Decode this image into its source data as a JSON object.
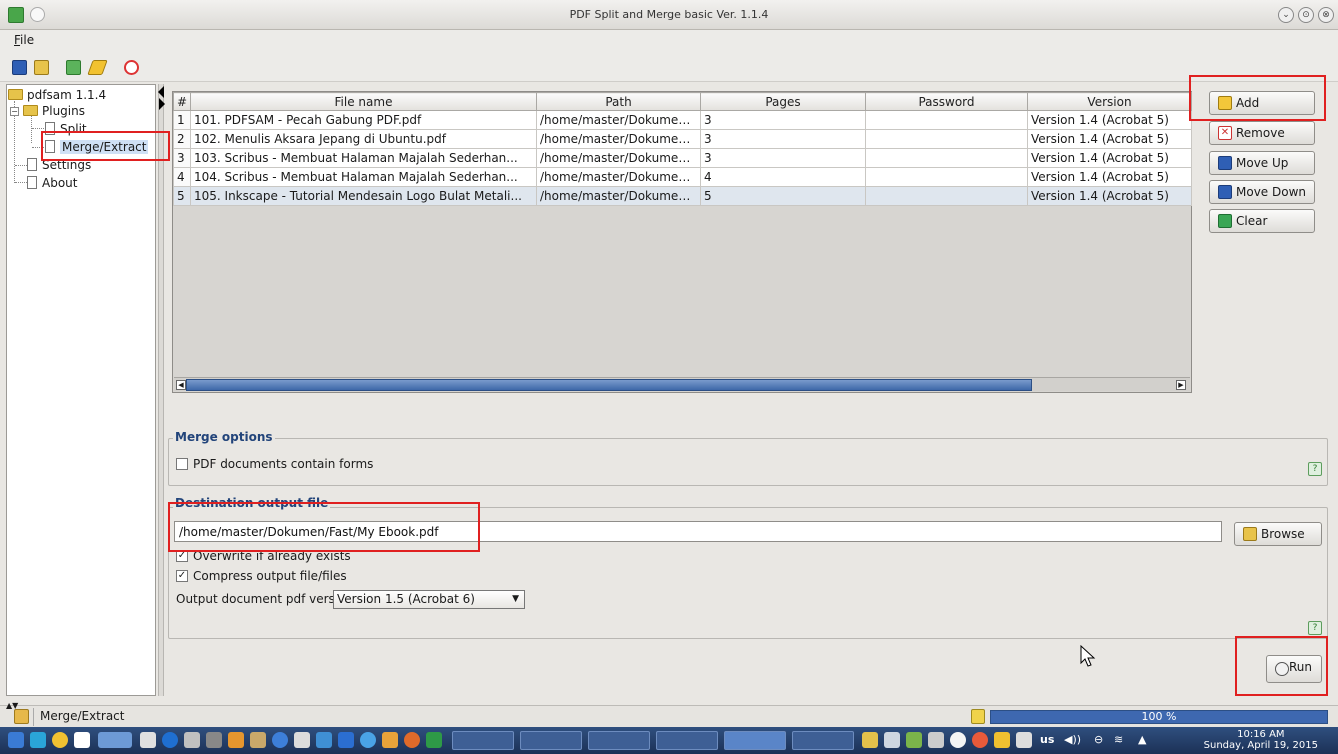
{
  "window": {
    "title": "PDF Split and Merge basic Ver. 1.1.4",
    "controls": [
      "⌄",
      "⊙",
      "⊗"
    ]
  },
  "menubar": {
    "file_mnemonic": "F",
    "file_rest": "ile"
  },
  "tree": {
    "root": "pdfsam 1.1.4",
    "plugins": "Plugins",
    "split": "Split",
    "merge": "Merge/Extract",
    "settings": "Settings",
    "about": "About"
  },
  "table": {
    "headers": [
      "#",
      "File name",
      "Path",
      "Pages",
      "Password",
      "Version"
    ],
    "rows": [
      [
        "1",
        "101. PDFSAM - Pecah Gabung PDF.pdf",
        "/home/master/Dokumen...",
        "3",
        "",
        "Version 1.4 (Acrobat 5)"
      ],
      [
        "2",
        "102. Menulis Aksara Jepang di Ubuntu.pdf",
        "/home/master/Dokumen...",
        "3",
        "",
        "Version 1.4 (Acrobat 5)"
      ],
      [
        "3",
        "103. Scribus - Membuat Halaman Majalah Sederhan...",
        "/home/master/Dokumen...",
        "3",
        "",
        "Version 1.4 (Acrobat 5)"
      ],
      [
        "4",
        "104. Scribus - Membuat Halaman Majalah Sederhan...",
        "/home/master/Dokumen...",
        "4",
        "",
        "Version 1.4 (Acrobat 5)"
      ],
      [
        "5",
        "105. Inkscape - Tutorial Mendesain Logo Bulat Metali...",
        "/home/master/Dokumen...",
        "5",
        "",
        "Version 1.4 (Acrobat 5)"
      ]
    ],
    "selected_row": 4
  },
  "buttons": {
    "add": "Add",
    "remove": "Remove",
    "move_up": "Move Up",
    "move_down": "Move Down",
    "clear": "Clear",
    "browse": "Browse",
    "run": "Run"
  },
  "merge_options": {
    "title": "Merge options",
    "forms_label": "PDF documents contain forms",
    "forms_checked": false
  },
  "destination": {
    "title": "Destination output file",
    "path": "/home/master/Dokumen/Fast/My Ebook.pdf",
    "overwrite_label": "Overwrite if already exists",
    "overwrite_checked": true,
    "compress_label": "Compress output file/files",
    "compress_checked": true,
    "version_label": "Output document pdf version:",
    "version_value": "Version 1.5 (Acrobat 6)"
  },
  "status": {
    "text": "Merge/Extract",
    "progress_value": 100,
    "progress_label": "100 %"
  },
  "taskbar": {
    "keyboard": "us",
    "clock_time": "10:16 AM",
    "clock_date": "Sunday, April 19, 2015"
  },
  "colors": {
    "highlight_box": "#e02020",
    "progress": "#3e68b0",
    "selected_row": "#dfe6ee",
    "group_title": "#22447a"
  }
}
